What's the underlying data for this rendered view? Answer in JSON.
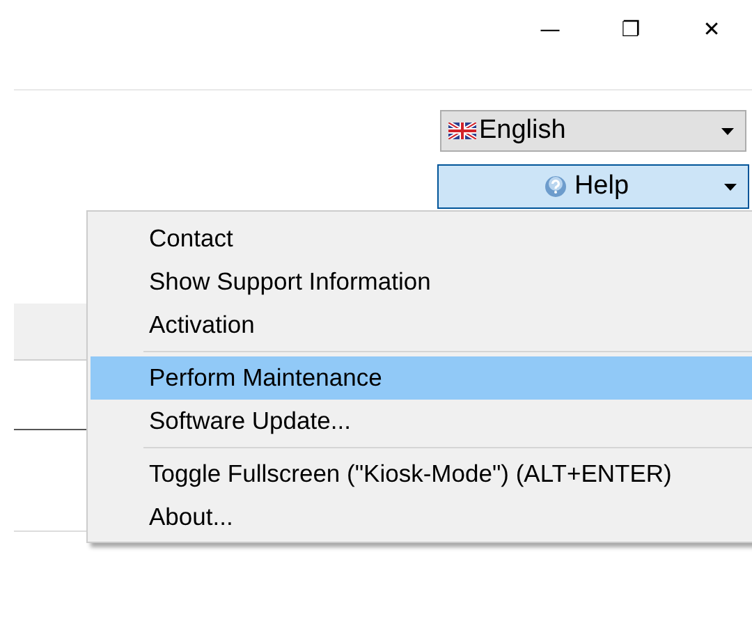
{
  "window_controls": {
    "minimize": "—",
    "restore": "❐",
    "close": "✕"
  },
  "language": {
    "value": "English"
  },
  "help_button": {
    "label": "Help"
  },
  "menu": [
    {
      "kind": "item",
      "label": "Contact",
      "selected": false
    },
    {
      "kind": "item",
      "label": "Show Support Information",
      "selected": false
    },
    {
      "kind": "item",
      "label": "Activation",
      "selected": false
    },
    {
      "kind": "separator"
    },
    {
      "kind": "item",
      "label": "Perform Maintenance",
      "selected": true
    },
    {
      "kind": "item",
      "label": "Software Update...",
      "selected": false
    },
    {
      "kind": "separator"
    },
    {
      "kind": "item",
      "label": "Toggle Fullscreen (\"Kiosk-Mode\") (ALT+ENTER)",
      "selected": false
    },
    {
      "kind": "item",
      "label": "About...",
      "selected": false
    }
  ]
}
